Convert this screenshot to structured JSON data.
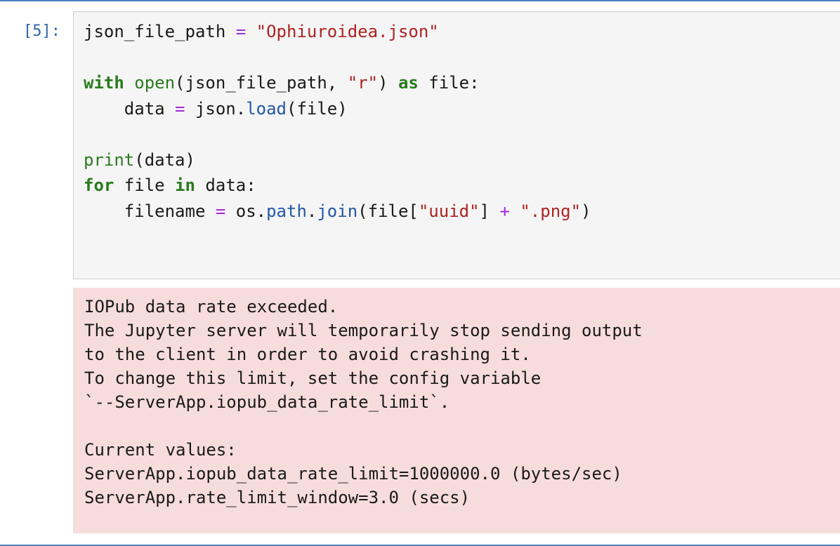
{
  "cell": {
    "prompt": "[5]:"
  },
  "code": {
    "line1": {
      "var": "json_file_path",
      "eq": "=",
      "str": "\"Ophiuroidea.json\""
    },
    "line3": {
      "with": "with",
      "open": "open",
      "args_a": "(json_file_path, ",
      "r": "\"r\"",
      "args_b": ") ",
      "as": "as",
      "rest": " file:"
    },
    "line4": {
      "indent": "    data ",
      "eq": "=",
      "mid": " json.",
      "load": "load",
      "rest": "(file)"
    },
    "line6": {
      "print": "print",
      "rest": "(data)"
    },
    "line7": {
      "for": "for",
      "mid": " file ",
      "in": "in",
      "rest": " data:"
    },
    "line8": {
      "indent": "    filename ",
      "eq": "=",
      "mid": " os.",
      "path": "path",
      "dot": ".",
      "join": "join",
      "open_paren": "(file[",
      "uuid": "\"uuid\"",
      "close_bracket": "] ",
      "plus": "+",
      "sp": " ",
      "png": "\".png\"",
      "close": ")"
    }
  },
  "output": {
    "lines": [
      "IOPub data rate exceeded.",
      "The Jupyter server will temporarily stop sending output",
      "to the client in order to avoid crashing it.",
      "To change this limit, set the config variable",
      "`--ServerApp.iopub_data_rate_limit`.",
      "",
      "Current values:",
      "ServerApp.iopub_data_rate_limit=1000000.0 (bytes/sec)",
      "ServerApp.rate_limit_window=3.0 (secs)"
    ]
  },
  "colors": {
    "border": "#4a7fbf",
    "prompt": "#2f64a8",
    "editor_bg": "#f5f5f5",
    "stderr_bg": "#f7dcdc",
    "keyword": "#2a7a1e",
    "string": "#ad2222",
    "operator": "#a32bd8",
    "attribute": "#2358a6"
  }
}
